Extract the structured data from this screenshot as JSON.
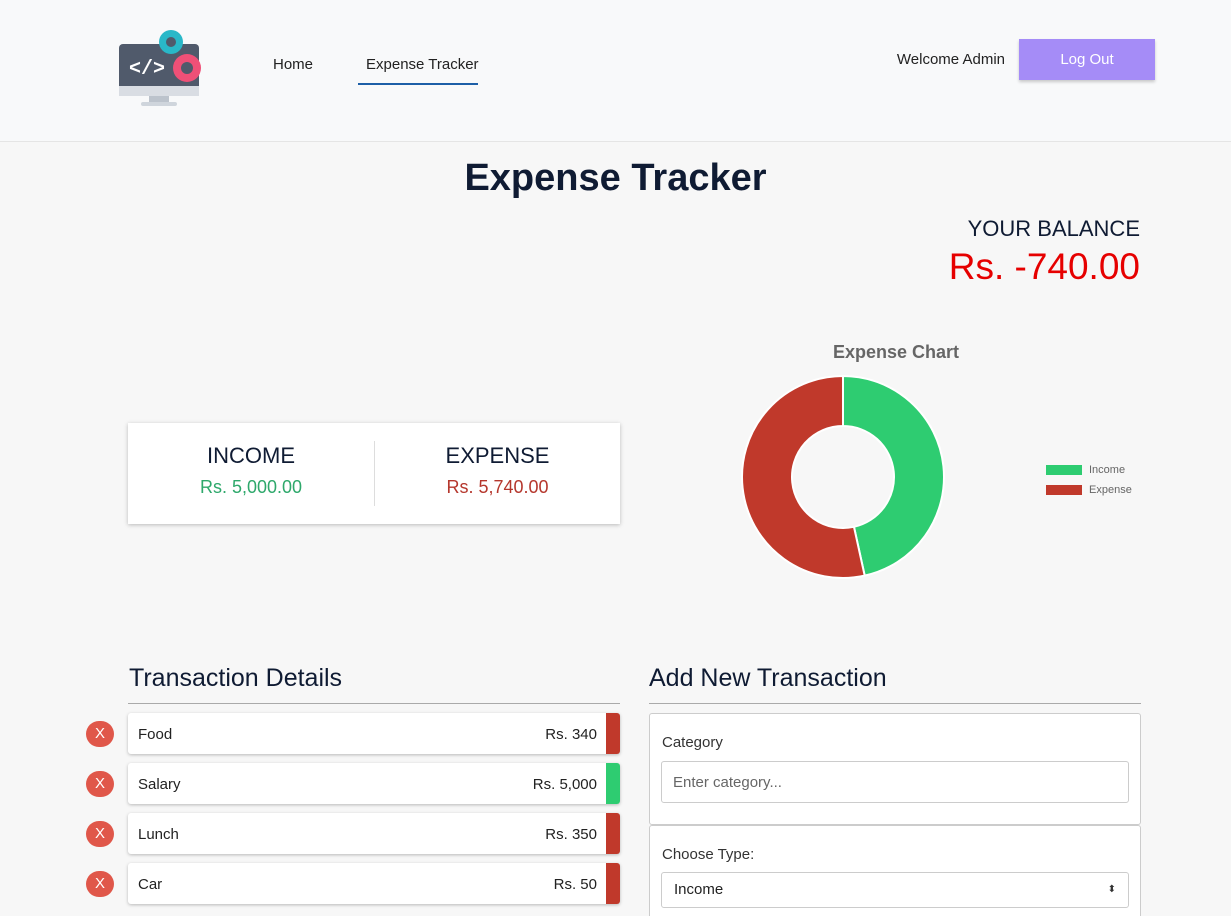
{
  "nav": {
    "home": "Home",
    "expense_tracker": "Expense Tracker",
    "welcome": "Welcome Admin",
    "logout": "Log Out"
  },
  "page": {
    "title": "Expense Tracker",
    "balance_label": "YOUR BALANCE",
    "balance_value": "Rs. -740.00"
  },
  "summary": {
    "income_label": "INCOME",
    "income_value": "Rs. 5,000.00",
    "expense_label": "EXPENSE",
    "expense_value": "Rs. 5,740.00"
  },
  "chart_data": {
    "type": "pie",
    "title": "Expense Chart",
    "categories": [
      "Income",
      "Expense"
    ],
    "values": [
      5000,
      5740
    ],
    "colors": [
      "#2ecc71",
      "#c0392b"
    ],
    "legend": "right"
  },
  "transactions": {
    "title": "Transaction Details",
    "items": [
      {
        "name": "Food",
        "amount": "Rs. 340",
        "color": "#c0392b"
      },
      {
        "name": "Salary",
        "amount": "Rs. 5,000",
        "color": "#2ecc71"
      },
      {
        "name": "Lunch",
        "amount": "Rs. 350",
        "color": "#c0392b"
      },
      {
        "name": "Car",
        "amount": "Rs. 50",
        "color": "#c0392b"
      }
    ],
    "delete_label": "X"
  },
  "add_form": {
    "title": "Add New Transaction",
    "category_label": "Category",
    "category_placeholder": "Enter category...",
    "type_label": "Choose Type:",
    "type_value": "Income"
  }
}
